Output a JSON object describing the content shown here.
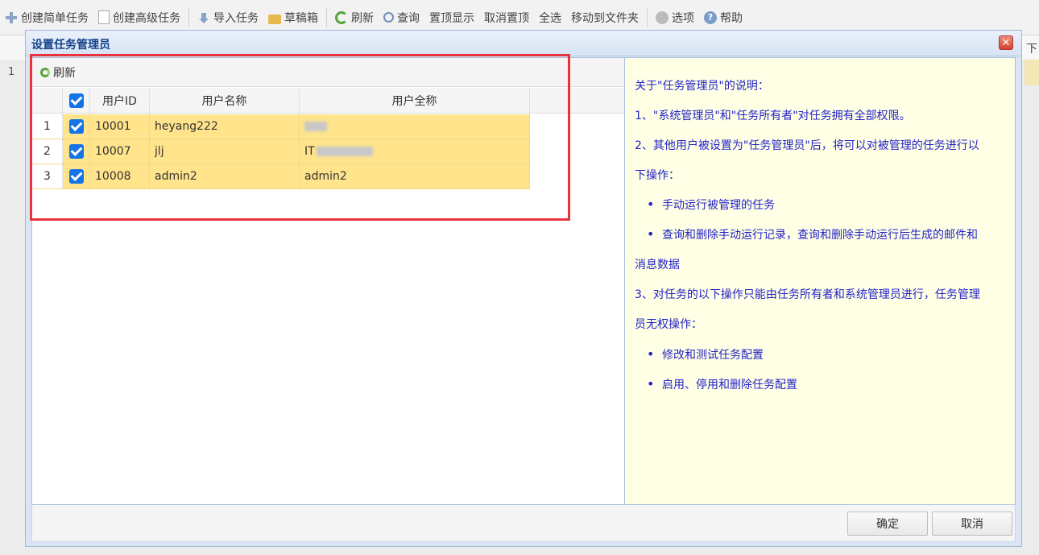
{
  "toolbar": {
    "items": [
      {
        "label": "创建简单任务",
        "icon": "plus-icon"
      },
      {
        "label": "创建高级任务",
        "icon": "document-icon"
      },
      {
        "label": "导入任务",
        "icon": "import-icon"
      },
      {
        "label": "草稿箱",
        "icon": "folder-icon"
      },
      {
        "label": "刷新",
        "icon": "refresh-icon"
      },
      {
        "label": "查询",
        "icon": "search-icon"
      },
      {
        "label": "置顶显示"
      },
      {
        "label": "取消置顶"
      },
      {
        "label": "全选"
      },
      {
        "label": "移动到文件夹"
      },
      {
        "label": "选项",
        "icon": "gear-icon"
      },
      {
        "label": "帮助",
        "icon": "help-icon"
      }
    ]
  },
  "background": {
    "row_number": "1",
    "right_label": "下"
  },
  "dialog": {
    "title": "设置任务管理员",
    "close_symbol": "✕",
    "refresh_label": "刷新",
    "columns": [
      "用户ID",
      "用户名称",
      "用户全称"
    ],
    "rows": [
      {
        "num": "1",
        "checked": true,
        "user_id": "10001",
        "user_name": "heyang222",
        "full_name": ""
      },
      {
        "num": "2",
        "checked": true,
        "user_id": "10007",
        "user_name": "jlj",
        "full_name": "IT"
      },
      {
        "num": "3",
        "checked": true,
        "user_id": "10008",
        "user_name": "admin2",
        "full_name": "admin2"
      }
    ],
    "confirm_label": "确定",
    "cancel_label": "取消"
  },
  "info": {
    "heading": "关于\"任务管理员\"的说明：",
    "p1": "1、\"系统管理员\"和\"任务所有者\"对任务拥有全部权限。",
    "p2_line1": "2、其他用户被设置为\"任务管理员\"后，将可以对被管理的任务进行以",
    "p2_line2": "下操作：",
    "b1": "手动运行被管理的任务",
    "b2": "查询和删除手动运行记录，查询和删除手动运行后生成的邮件和",
    "b2_cont": "消息数据",
    "p3_line1": "3、对任务的以下操作只能由任务所有者和系统管理员进行，任务管理",
    "p3_line2": "员无权操作：",
    "b3": "修改和测试任务配置",
    "b4": "启用、停用和删除任务配置"
  },
  "colors": {
    "highlight": "#e8333a",
    "info_text": "#2323c8",
    "row_selected": "#ffe48c",
    "checkbox": "#1473e6"
  }
}
